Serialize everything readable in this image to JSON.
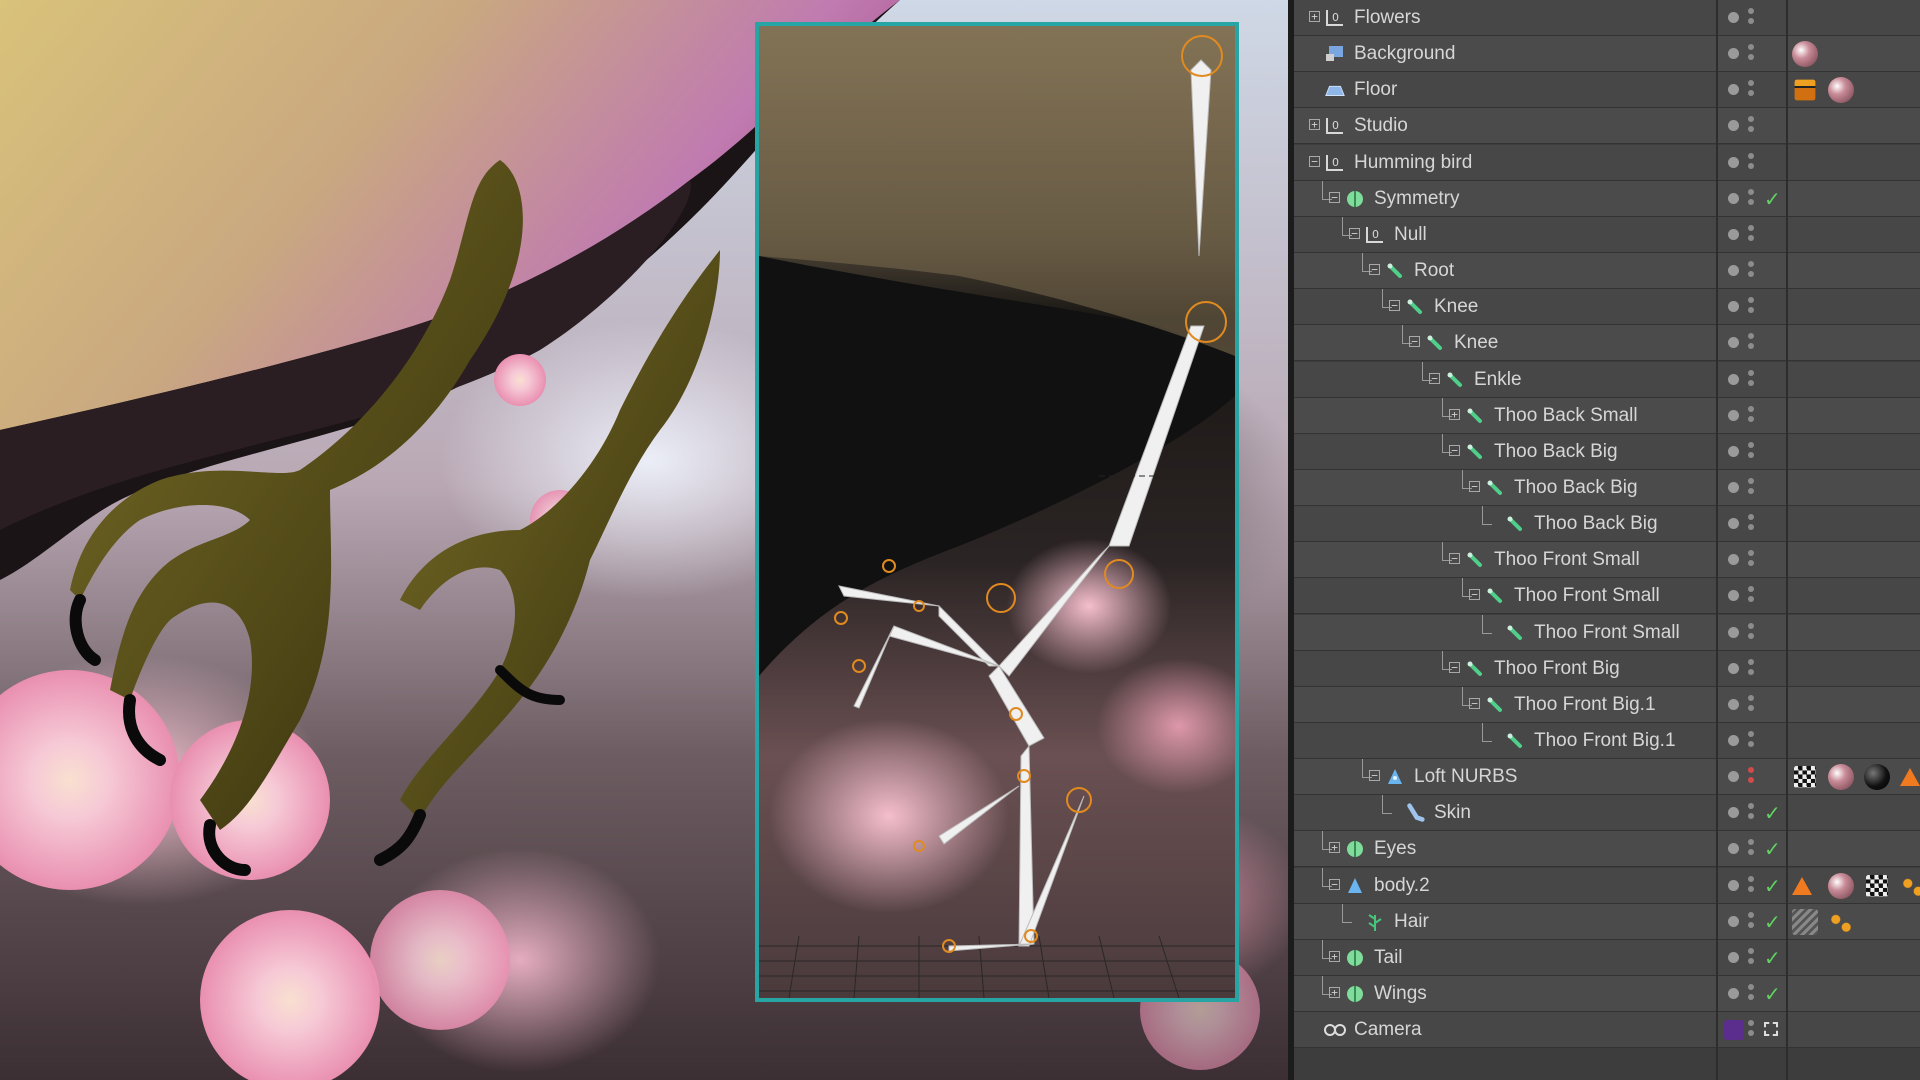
{
  "object_manager": {
    "items": [
      {
        "label": "Flowers",
        "icon": "null-icon",
        "level": 0,
        "expander": "+",
        "check": false,
        "tags": []
      },
      {
        "label": "Background",
        "icon": "background-icon",
        "level": 0,
        "expander": "",
        "check": false,
        "tags": [
          "material-tag"
        ]
      },
      {
        "label": "Floor",
        "icon": "floor-icon",
        "level": 0,
        "expander": "",
        "check": false,
        "tags": [
          "compositing-tag",
          "material-tag"
        ]
      },
      {
        "label": "Studio",
        "icon": "null-icon",
        "level": 0,
        "expander": "+",
        "check": false,
        "tags": []
      },
      {
        "label": "Humming bird",
        "icon": "null-icon",
        "level": 0,
        "expander": "-",
        "check": false,
        "tags": []
      },
      {
        "label": "Symmetry",
        "icon": "symmetry-icon",
        "level": 1,
        "expander": "-",
        "check": true,
        "tags": []
      },
      {
        "label": "Null",
        "icon": "null-icon",
        "level": 2,
        "expander": "-",
        "check": false,
        "tags": []
      },
      {
        "label": "Root",
        "icon": "joint-icon",
        "level": 3,
        "expander": "-",
        "check": false,
        "tags": []
      },
      {
        "label": "Knee",
        "icon": "joint-icon",
        "level": 4,
        "expander": "-",
        "check": false,
        "tags": []
      },
      {
        "label": "Knee",
        "icon": "joint-icon",
        "level": 5,
        "expander": "-",
        "check": false,
        "tags": []
      },
      {
        "label": "Enkle",
        "icon": "joint-icon",
        "level": 6,
        "expander": "-",
        "check": false,
        "tags": []
      },
      {
        "label": "Thoo Back Small",
        "icon": "joint-icon",
        "level": 7,
        "expander": "+",
        "check": false,
        "tags": []
      },
      {
        "label": "Thoo Back Big",
        "icon": "joint-icon",
        "level": 7,
        "expander": "-",
        "check": false,
        "tags": []
      },
      {
        "label": "Thoo Back Big",
        "icon": "joint-icon",
        "level": 8,
        "expander": "-",
        "check": false,
        "tags": []
      },
      {
        "label": "Thoo Back Big",
        "icon": "joint-icon",
        "level": 9,
        "expander": "",
        "check": false,
        "tags": []
      },
      {
        "label": "Thoo Front Small",
        "icon": "joint-icon",
        "level": 7,
        "expander": "-",
        "check": false,
        "tags": []
      },
      {
        "label": "Thoo Front Small",
        "icon": "joint-icon",
        "level": 8,
        "expander": "-",
        "check": false,
        "tags": []
      },
      {
        "label": "Thoo Front Small",
        "icon": "joint-icon",
        "level": 9,
        "expander": "",
        "check": false,
        "tags": []
      },
      {
        "label": "Thoo Front Big",
        "icon": "joint-icon",
        "level": 7,
        "expander": "-",
        "check": false,
        "tags": []
      },
      {
        "label": "Thoo Front Big.1",
        "icon": "joint-icon",
        "level": 8,
        "expander": "-",
        "check": false,
        "tags": []
      },
      {
        "label": "Thoo Front Big.1",
        "icon": "joint-icon",
        "level": 9,
        "expander": "",
        "check": false,
        "tags": []
      },
      {
        "label": "Loft NURBS",
        "icon": "loft-nurbs-icon",
        "level": 3,
        "expander": "-",
        "check": false,
        "red": true,
        "tags": [
          "checker-tag",
          "material-tag",
          "material-black-tag",
          "ik-tag"
        ]
      },
      {
        "label": "Skin",
        "icon": "skin-icon",
        "level": 4,
        "expander": "",
        "check": true,
        "tags": []
      },
      {
        "label": "Eyes",
        "icon": "symmetry-icon",
        "level": 1,
        "expander": "+",
        "check": true,
        "tags": []
      },
      {
        "label": "body.2",
        "icon": "polygon-icon",
        "level": 1,
        "expander": "-",
        "check": true,
        "tags": [
          "ik-tag",
          "material-tag",
          "checker-tag",
          "hair-dots-tag"
        ]
      },
      {
        "label": "Hair",
        "icon": "hair-icon",
        "level": 2,
        "expander": "",
        "check": true,
        "tags": [
          "hair-material-tag",
          "hair-dots-tag"
        ]
      },
      {
        "label": "Tail",
        "icon": "symmetry-icon",
        "level": 1,
        "expander": "+",
        "check": true,
        "tags": []
      },
      {
        "label": "Wings",
        "icon": "symmetry-icon",
        "level": 1,
        "expander": "+",
        "check": true,
        "tags": []
      },
      {
        "label": "Camera",
        "icon": "camera-icon",
        "level": 0,
        "expander": "",
        "check": false,
        "camera": true,
        "tags": []
      }
    ]
  },
  "colors": {
    "viewport_border": "#27a5a5",
    "check": "#62d162",
    "joint_icon": "#4fcf8a",
    "symmetry_icon": "#7fdc9a",
    "camera_swatch": "#5b2d8c"
  }
}
